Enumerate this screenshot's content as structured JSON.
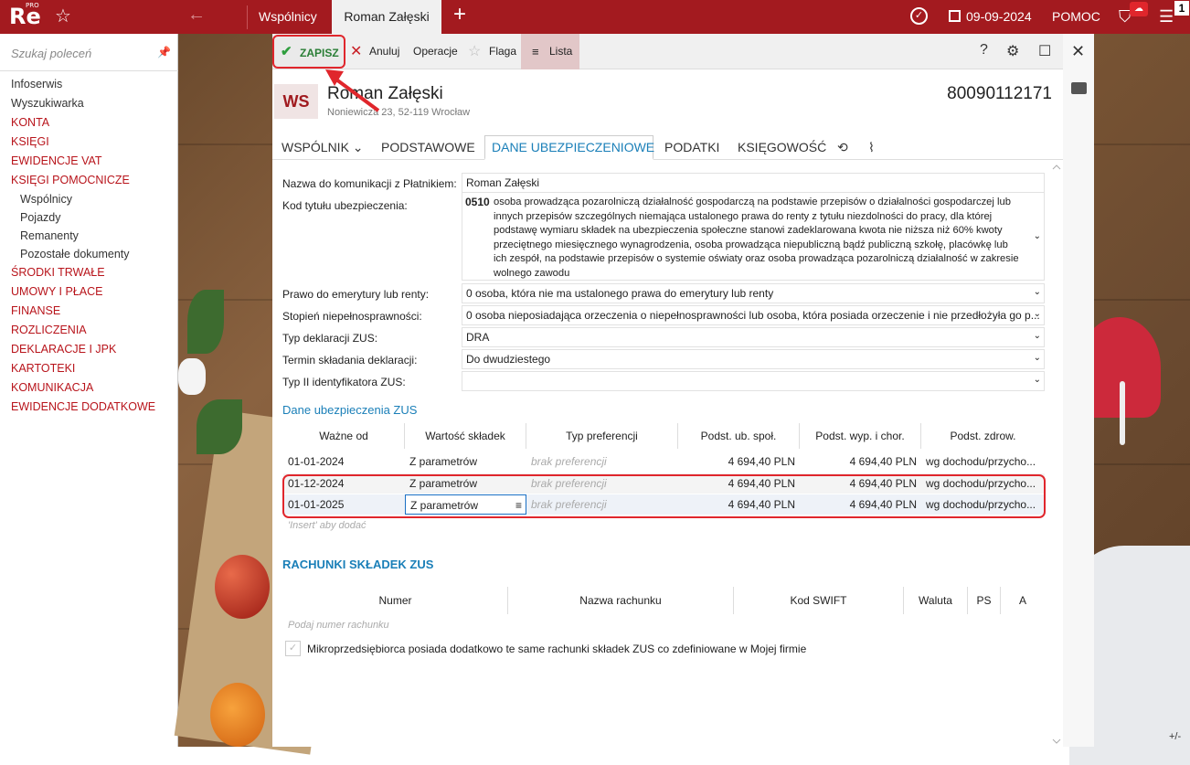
{
  "topbar": {
    "logo": "Re",
    "logo_badge": "PRO",
    "tabs": [
      "Wspólnicy",
      "Roman Załęski"
    ],
    "date": "09-09-2024",
    "help": "POMOC",
    "badge_count": "1"
  },
  "sidebar": {
    "search_placeholder": "Szukaj poleceń",
    "items": [
      {
        "label": "Infoserwis",
        "style": "dark"
      },
      {
        "label": "Wyszukiwarka",
        "style": "dark"
      },
      {
        "label": "KONTA",
        "style": "red"
      },
      {
        "label": "KSIĘGI",
        "style": "red"
      },
      {
        "label": "EWIDENCJE VAT",
        "style": "red"
      },
      {
        "label": "KSIĘGI POMOCNICZE",
        "style": "red"
      },
      {
        "label": "Wspólnicy",
        "style": "sub"
      },
      {
        "label": "Pojazdy",
        "style": "sub"
      },
      {
        "label": "Remanenty",
        "style": "sub"
      },
      {
        "label": "Pozostałe dokumenty",
        "style": "sub"
      },
      {
        "label": "ŚRODKI TRWAŁE",
        "style": "red"
      },
      {
        "label": "UMOWY I PŁACE",
        "style": "red"
      },
      {
        "label": "FINANSE",
        "style": "red"
      },
      {
        "label": "ROZLICZENIA",
        "style": "red"
      },
      {
        "label": "DEKLARACJE I JPK",
        "style": "red"
      },
      {
        "label": "KARTOTEKI",
        "style": "red"
      },
      {
        "label": "KOMUNIKACJA",
        "style": "red"
      },
      {
        "label": "EWIDENCJE DODATKOWE",
        "style": "red"
      }
    ]
  },
  "toolbar": {
    "save": "ZAPISZ",
    "cancel": "Anuluj",
    "operations": "Operacje",
    "flag": "Flaga",
    "list": "Lista",
    "help": "?"
  },
  "record": {
    "initials": "WS",
    "name": "Roman Załęski",
    "address": "Noniewicza 23, 52-119 Wrocław",
    "nip": "80090112171"
  },
  "tabs": [
    "WSPÓLNIK",
    "PODSTAWOWE",
    "DANE UBEZPIECZENIOWE",
    "PODATKI",
    "KSIĘGOWOŚĆ"
  ],
  "form": {
    "nazwa_label": "Nazwa do komunikacji z Płatnikiem:",
    "nazwa_value": "Roman Załęski",
    "kod_label": "Kod tytułu ubezpieczenia:",
    "kod_code": "0510",
    "kod_text": "osoba prowadząca pozarolniczą działalność gospodarczą na podstawie przepisów o działalności gospodarczej lub innych przepisów szczególnych niemająca ustalonego prawa do renty z tytułu niezdolności do pracy, dla której podstawę wymiaru składek na ubezpieczenia społeczne stanowi zadeklarowana kwota nie niższa niż 60% kwoty przeciętnego miesięcznego wynagrodzenia, osoba prowadząca niepubliczną bądź publiczną szkołę, placówkę lub ich zespół, na podstawie przepisów o systemie oświaty oraz osoba prowadząca pozarolniczą działalność w zakresie wolnego zawodu",
    "prawo_label": "Prawo do emerytury lub renty:",
    "prawo_value": "0  osoba, która nie ma ustalonego prawa do emerytury lub renty",
    "stopien_label": "Stopień niepełnosprawności:",
    "stopien_value": "0  osoba nieposiadająca orzeczenia o niepełnosprawności lub osoba, która posiada orzeczenie i nie przedłożyła go p...",
    "typdek_label": "Typ deklaracji ZUS:",
    "typdek_value": "DRA",
    "termin_label": "Termin składania deklaracji:",
    "termin_value": "Do dwudziestego",
    "typid_label": "Typ II identyfikatora ZUS:",
    "typid_value": ""
  },
  "zus_section": {
    "title": "Dane ubezpieczenia ZUS",
    "columns": [
      "Ważne od",
      "Wartość składek",
      "Typ preferencji",
      "Podst. ub. społ.",
      "Podst. wyp. i chor.",
      "Podst. zdrow."
    ],
    "rows": [
      [
        "01-01-2024",
        "Z parametrów",
        "brak preferencji",
        "4 694,40 PLN",
        "4 694,40 PLN",
        "wg dochodu/przycho..."
      ],
      [
        "01-12-2024",
        "Z parametrów",
        "brak preferencji",
        "4 694,40 PLN",
        "4 694,40 PLN",
        "wg dochodu/przycho..."
      ],
      [
        "01-01-2025",
        "Z parametrów",
        "brak preferencji",
        "4 694,40 PLN",
        "4 694,40 PLN",
        "wg dochodu/przycho..."
      ]
    ],
    "insert_hint": "'Insert' aby dodać"
  },
  "accounts": {
    "title": "RACHUNKI SKŁADEK ZUS",
    "columns": [
      "Numer",
      "Nazwa rachunku",
      "Kod SWIFT",
      "Waluta",
      "PS",
      "A"
    ],
    "placeholder": "Podaj numer rachunku",
    "checkbox_label": "Mikroprzedsiębiorca posiada dodatkowo te same rachunki składek ZUS co zdefiniowane w Mojej firmie"
  },
  "footer": {
    "zoom": "+/-"
  },
  "colors": {
    "brand": "#a31a1f",
    "accent": "#1a7fb8",
    "highlight": "#e0262c",
    "save_green": "#2e9e3e"
  }
}
